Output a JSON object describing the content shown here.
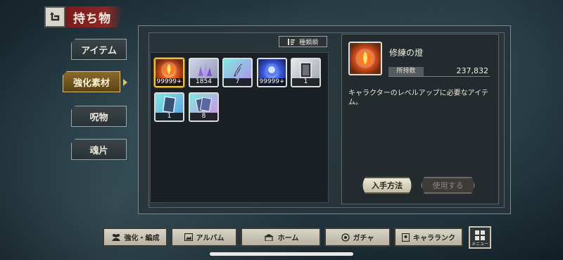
{
  "header": {
    "title": "持ち物",
    "back_icon": "back-arrow-icon"
  },
  "tabs": [
    {
      "label": "アイテム",
      "active": false
    },
    {
      "label": "強化素材",
      "active": true
    },
    {
      "label": "呪物",
      "active": false
    },
    {
      "label": "魂片",
      "active": false
    }
  ],
  "sort_button": {
    "label": "種類順",
    "icon": "sort-icon"
  },
  "items": [
    {
      "icon": "flame-orb-icon",
      "qty": "99999+",
      "selected": true
    },
    {
      "icon": "crystal-cluster-icon",
      "qty": "1854",
      "selected": false
    },
    {
      "icon": "feather-shard-icon",
      "qty": "7",
      "selected": false
    },
    {
      "icon": "blue-orb-icon",
      "qty": "99999+",
      "selected": false
    },
    {
      "icon": "silver-card-icon",
      "qty": "1",
      "selected": false
    },
    {
      "icon": "cyan-card-icon",
      "qty": "1",
      "selected": false
    },
    {
      "icon": "card-stack-icon",
      "qty": "8",
      "selected": false
    }
  ],
  "detail": {
    "name": "修練の燈",
    "stock_label": "所持数",
    "stock_value": "237,832",
    "description": "キャラクターのレベルアップに必要なアイテム。",
    "acquire_button": "入手方法",
    "use_button": "使用する"
  },
  "bottom_nav": [
    {
      "label": "強化・編成",
      "icon": "party-icon"
    },
    {
      "label": "アルバム",
      "icon": "album-icon"
    },
    {
      "label": "ホーム",
      "icon": "home-icon"
    },
    {
      "label": "ガチャ",
      "icon": "gacha-icon"
    },
    {
      "label": "キャラランク",
      "icon": "rank-icon"
    }
  ],
  "menu_button": {
    "label": "メニュー",
    "icon": "grid-menu-icon"
  },
  "colors": {
    "accent_red": "#8e2626",
    "active_tab_gold": "#e0c070",
    "panel_bg": "#28343a"
  }
}
